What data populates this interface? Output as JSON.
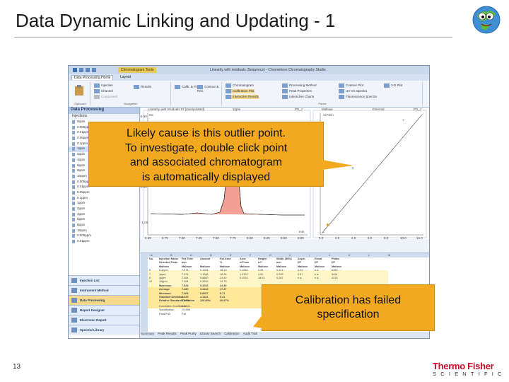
{
  "slide": {
    "title": "Data Dynamic Linking and Updating - 1",
    "page_number": "13"
  },
  "brand": {
    "line1": "Thermo Fisher",
    "line2": "SCIENTIFIC",
    "color": "#c8102e"
  },
  "callouts": [
    {
      "text_lines": [
        "Likely cause is this outlier point.",
        "To investigate, double click point",
        "and associated chromatogram",
        "is automatically displayed"
      ]
    },
    {
      "text_lines": [
        "Calibration has failed",
        "specification"
      ]
    }
  ],
  "app": {
    "window_title": "Linearity with residuals (Sequence) - Chromeleon Chromatography Studio",
    "context_tab": "Chromatogram Tools",
    "tabs": [
      "Data Processing Home",
      "Layout"
    ],
    "ribbon": {
      "groups": [
        "Clipboard",
        "Navigation",
        "Panes"
      ],
      "buttons": [
        "Injection",
        "Channel",
        "Component",
        "Results",
        "Calib. & Pt",
        "Contour & Res.",
        "Chromatogram",
        "Calibration Plot",
        "Interactive Results",
        "Processing Method",
        "Peak Properties",
        "Interactive Charts",
        "Contour Plot",
        "UV-Vis Spectra",
        "Fluorescence Spectra",
        "3-D Plot"
      ]
    },
    "left_panel": {
      "header": "Data Processing",
      "subheader": "Injections",
      "items": [
        "0ppm",
        "0.005ppm",
        "0.01ppm",
        "0.05ppm",
        "0.1ppm",
        "1ppm",
        "2ppm",
        "4ppm",
        "6ppm",
        "8ppm",
        "10ppm",
        "0.005ppm",
        "0.01ppm",
        "0.05ppm",
        "0.1ppm",
        "1ppm",
        "2ppm",
        "4ppm",
        "6ppm",
        "8ppm",
        "10ppm",
        "0.005ppm",
        "0.01ppm"
      ],
      "selected_index": 5,
      "nav": [
        "Injection List",
        "Instrument Method",
        "Data Processing",
        "Report Designer",
        "Electronic Report",
        "Spectral Library"
      ],
      "active_nav_index": 2
    },
    "chromatogram": {
      "header": "Linearity with residuals #7 [manipulated]",
      "channel": "ED_1",
      "amount": "1ppm",
      "y_label": "nC",
      "y_ticks": [
        "6.50",
        "1.00",
        "0.00",
        "-1.00"
      ],
      "x_ticks": [
        "6.65",
        "6.75",
        "7.00",
        "7.25",
        "7.50",
        "7.75",
        "8.00",
        "8.25",
        "8.50",
        "8.80"
      ],
      "x_unit": "min"
    },
    "calibration": {
      "header_left": "Maltose",
      "header_mid": "External",
      "header_right": "ED_1",
      "y_label": "nC*min",
      "x_ticks": [
        "0.0",
        "2.0",
        "4.0",
        "6.0",
        "8.0",
        "10.0",
        "12.0"
      ]
    },
    "table": {
      "columns": [
        "A",
        "B",
        "C",
        "D",
        "E",
        "F",
        "G",
        "H",
        "I",
        "J",
        "K",
        "L",
        "M"
      ],
      "header_rows": [
        [
          "No.",
          "Injection Name",
          "Ret.Time",
          "Amount",
          "Rel.Area",
          "Area",
          "Height",
          "Width (50%)",
          "Asym.",
          "Resol.",
          "Plates"
        ],
        [
          "",
          "Selected Peak:",
          "min",
          "",
          "%",
          "nC*min",
          "nC",
          "min",
          "EP",
          "EP",
          "EP"
        ],
        [
          "",
          "Maltose",
          "Maltose",
          "Maltose",
          "Maltose",
          "Maltose",
          "Maltose",
          "Maltose",
          "Maltose",
          "Maltose",
          "Maltose"
        ]
      ],
      "rows": [
        [
          "5",
          "0.1ppm",
          "7.474",
          "0.1154",
          "18.10",
          "0.1054",
          "0.45",
          "0.221",
          "1.01",
          "n.a.",
          "6350"
        ],
        [
          "7",
          "1ppm",
          "7.474",
          "1.1066",
          "18.26",
          "1.0102",
          "4.00",
          "0.239",
          "0.97",
          "n.a.",
          "5404"
        ],
        [
          "9",
          "4ppm",
          "7.464",
          "6.6800",
          "24.49",
          "5.1516",
          "18.61",
          "0.287",
          "n.a.",
          "n.a.",
          "4315"
        ],
        [
          "12",
          "10ppm",
          "7.464",
          "9.3252",
          "19.79",
          "",
          "",
          "",
          "",
          "",
          ""
        ]
      ],
      "stats": [
        [
          "Maximum",
          "7.524",
          "9.3252",
          "24.49"
        ],
        [
          "Average",
          "7.480",
          "3.2432",
          "17.47"
        ],
        [
          "Minimum",
          "7.464",
          "0.0007",
          "9.71"
        ],
        [
          "Standard Deviation",
          "0.025",
          "4.1122",
          "5.41"
        ],
        [
          "Relative Standard Deviation",
          "0.34%",
          "126.80%",
          "30.97%"
        ]
      ],
      "calibration_rows": [
        [
          "Correlation Coefficient",
          "0.8618"
        ],
        [
          "Specification",
          ">0.998"
        ],
        [
          "Pass/Fail",
          "Fail"
        ]
      ]
    },
    "bottom_tabs": [
      "Summary",
      "Peak Results",
      "Peak Purity",
      "Library Search",
      "Calibration",
      "Audit Trail"
    ]
  }
}
